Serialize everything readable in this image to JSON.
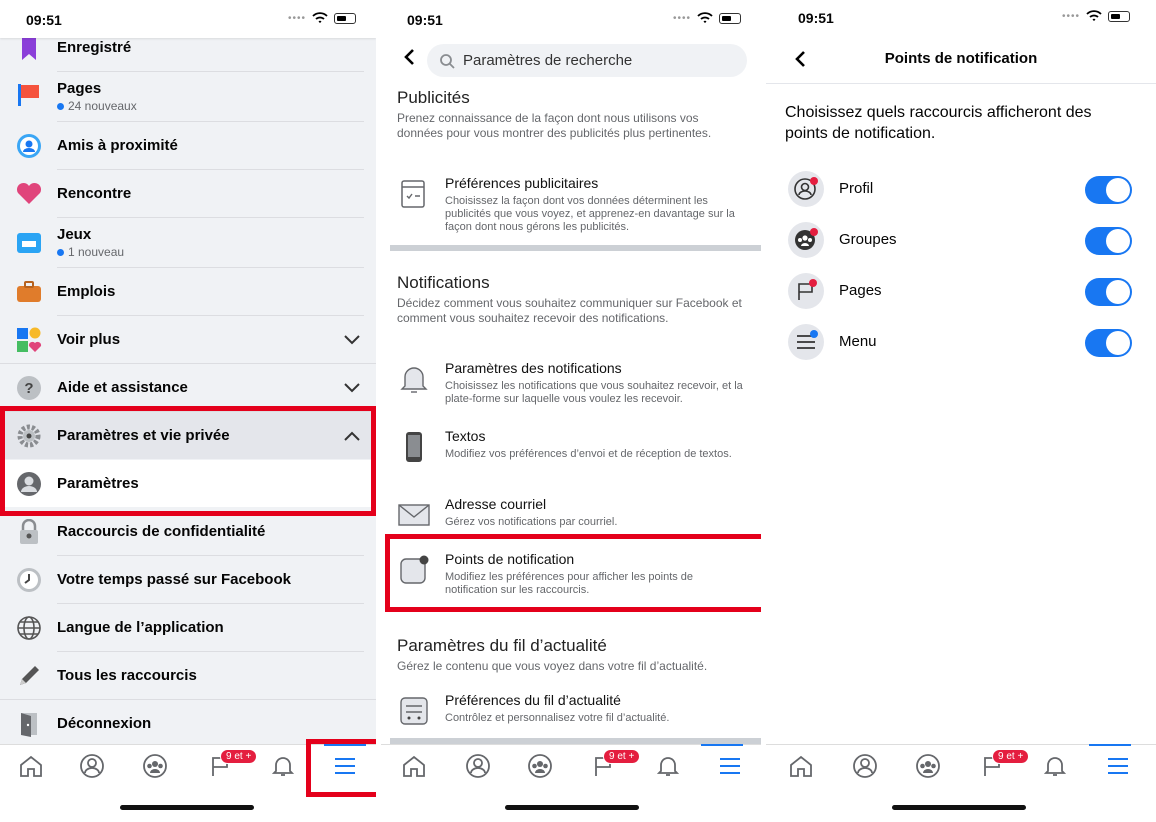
{
  "status": {
    "time": "09:51"
  },
  "screen1": {
    "items": [
      {
        "label": "Enregistré"
      },
      {
        "label": "Pages",
        "sub": "24 nouveaux"
      },
      {
        "label": "Amis à proximité"
      },
      {
        "label": "Rencontre"
      },
      {
        "label": "Jeux",
        "sub": "1 nouveau"
      },
      {
        "label": "Emplois"
      },
      {
        "label": "Voir plus"
      },
      {
        "label": "Aide et assistance"
      },
      {
        "label": "Paramètres et vie privée"
      },
      {
        "label": "Paramètres"
      },
      {
        "label": "Raccourcis de confidentialité"
      },
      {
        "label": "Votre temps passé sur Facebook"
      },
      {
        "label": "Langue de l’application"
      },
      {
        "label": "Tous les raccourcis"
      },
      {
        "label": "Déconnexion"
      }
    ]
  },
  "tabbar": {
    "badge": "9 et +"
  },
  "screen2": {
    "search_label": "Paramètres de recherche",
    "ads": {
      "heading": "Publicités",
      "desc": "Prenez connaissance de la façon dont nous utilisons vos données pour vous montrer des publicités plus pertinentes.",
      "row": {
        "title": "Préférences publicitaires",
        "desc": "Choisissez la façon dont vos données déterminent les publicités que vous voyez, et apprenez-en davantage sur la façon dont nous gérons les publicités."
      }
    },
    "notifications": {
      "heading": "Notifications",
      "desc": "Décidez comment vous souhaitez communiquer sur Facebook et comment vous souhaitez recevoir des notifications.",
      "rows": [
        {
          "title": "Paramètres des notifications",
          "desc": "Choisissez les notifications que vous souhaitez recevoir, et la plate-forme sur laquelle vous voulez les recevoir."
        },
        {
          "title": "Textos",
          "desc": "Modifiez vos préférences d’envoi et de réception de textos."
        },
        {
          "title": "Adresse courriel",
          "desc": "Gérez vos notifications par courriel."
        },
        {
          "title": "Points de notification",
          "desc": "Modifiez les préférences pour afficher les points de notification sur les raccourcis."
        }
      ]
    },
    "feed": {
      "heading": "Paramètres du fil d’actualité",
      "desc": "Gérez le contenu que vous voyez dans votre fil d’actualité.",
      "row": {
        "title": "Préférences du fil d’actualité",
        "desc": "Contrôlez et personnalisez votre fil d’actualité."
      }
    }
  },
  "screen3": {
    "title": "Points de notification",
    "intro": "Choisissez quels raccourcis afficheront des points de notification.",
    "toggles": [
      {
        "label": "Profil",
        "on": true
      },
      {
        "label": "Groupes",
        "on": true
      },
      {
        "label": "Pages",
        "on": true
      },
      {
        "label": "Menu",
        "on": true
      }
    ]
  },
  "colors": {
    "accent": "#1877f2",
    "highlight": "#e4001b",
    "badge": "#e41e3f"
  }
}
